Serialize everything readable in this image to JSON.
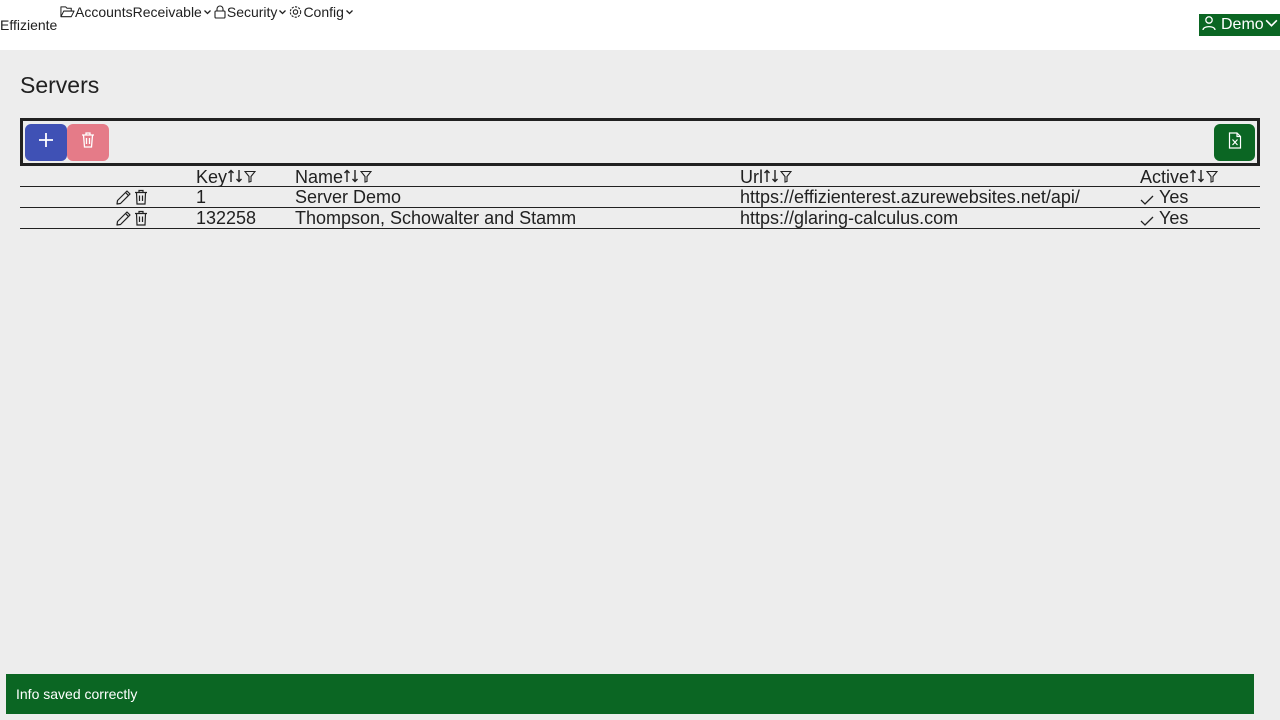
{
  "nav": {
    "brand": "Effiziente",
    "menu": [
      {
        "label": "AccountsReceivable",
        "icon": "folder-icon"
      },
      {
        "label": "Security",
        "icon": "lock-icon"
      },
      {
        "label": "Config",
        "icon": "gear-icon"
      }
    ],
    "user": "Demo"
  },
  "page": {
    "title": "Servers"
  },
  "toolbar": {
    "add_icon": "plus-icon",
    "delete_icon": "trash-icon",
    "export_icon": "excel-export-icon"
  },
  "table": {
    "columns": [
      {
        "label": "Key"
      },
      {
        "label": "Name"
      },
      {
        "label": "Url"
      },
      {
        "label": "Active"
      }
    ],
    "rows": [
      {
        "key": "1",
        "name": "Server Demo",
        "url": "https://effizienterest.azurewebsites.net/api/",
        "active": "Yes"
      },
      {
        "key": "132258",
        "name": "Thompson, Schowalter and Stamm",
        "url": "https://glaring-calculus.com",
        "active": "Yes"
      }
    ]
  },
  "toast": {
    "message": "Info saved correctly"
  },
  "colors": {
    "accent_green": "#0b6623",
    "add_blue": "#3f51b5",
    "delete_pink": "#e57b88",
    "background": "#ededed"
  }
}
